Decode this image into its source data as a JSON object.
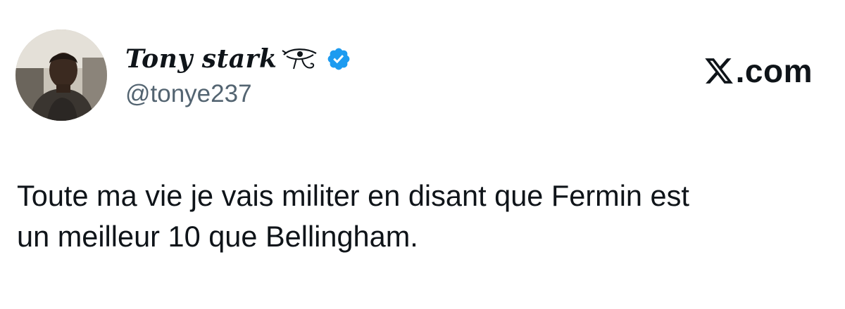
{
  "author": {
    "display_name": "Tony stark",
    "name_symbol_icon": "eye-of-horus-icon",
    "verified_icon": "verified-badge-icon",
    "handle": "@tonye237",
    "avatar_icon": "profile-photo"
  },
  "brand": {
    "logo_icon": "x-logo-icon",
    "text": ".com"
  },
  "tweet": {
    "lines": [
      "Toute ma vie je vais militer en disant que Fermin est",
      "un meilleur 10 que Bellingham."
    ]
  },
  "colors": {
    "text": "#0f1419",
    "handle": "#536471",
    "verified": "#1d9bf0",
    "background": "#ffffff"
  }
}
